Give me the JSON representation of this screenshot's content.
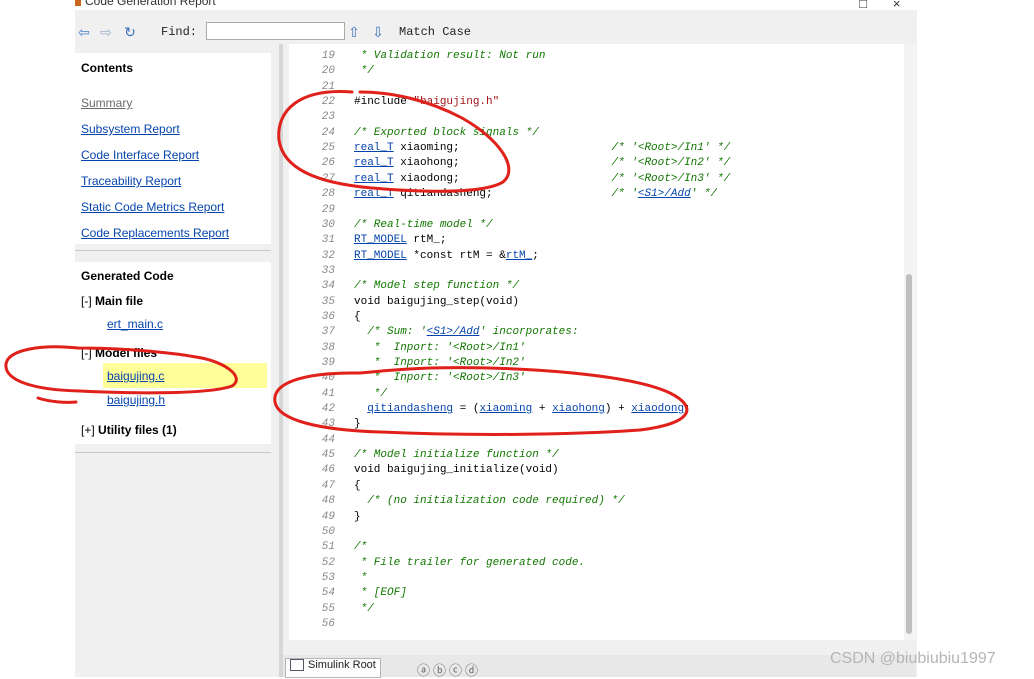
{
  "window": {
    "title": "Code Generation Report",
    "controls": {
      "minimize": "□",
      "close": "×"
    }
  },
  "toolbar": {
    "back_icon": "back-arrow-icon",
    "forward_icon": "forward-arrow-icon",
    "refresh_icon": "refresh-icon",
    "find_label": "Find:",
    "find_value": "",
    "find_prev_icon": "up-arrow-icon",
    "find_next_icon": "down-arrow-icon",
    "match_case": "Match Case"
  },
  "contents": {
    "heading": "Contents",
    "links": [
      "Summary",
      "Subsystem Report",
      "Code Interface Report",
      "Traceability Report",
      "Static Code Metrics Report",
      "Code Replacements Report"
    ]
  },
  "generated": {
    "heading": "Generated Code",
    "groups": [
      {
        "toggle": "[-]",
        "label": "Main file",
        "files": [
          "ert_main.c"
        ]
      },
      {
        "toggle": "[-]",
        "label": "Model files",
        "files": [
          "baigujing.c",
          "baigujing.h"
        ]
      },
      {
        "toggle": "[+]",
        "label": "Utility files (1)",
        "files": []
      }
    ]
  },
  "code": [
    {
      "n": "19",
      "t": " * Validation result: Not run"
    },
    {
      "n": "20",
      "t": " */"
    },
    {
      "n": "21",
      "t": ""
    },
    {
      "n": "22",
      "t": "#include \"baigujing.h\""
    },
    {
      "n": "23",
      "t": ""
    },
    {
      "n": "24",
      "t": "/* Exported block signals */"
    },
    {
      "n": "25",
      "t": "real_T xiaoming;                       /* '<Root>/In1' */"
    },
    {
      "n": "26",
      "t": "real_T xiaohong;                       /* '<Root>/In2' */"
    },
    {
      "n": "27",
      "t": "real_T xiaodong;                       /* '<Root>/In3' */"
    },
    {
      "n": "28",
      "t": "real_T qitiandasheng;                  /* '<S1>/Add' */"
    },
    {
      "n": "29",
      "t": ""
    },
    {
      "n": "30",
      "t": "/* Real-time model */"
    },
    {
      "n": "31",
      "t": "RT_MODEL rtM_;"
    },
    {
      "n": "32",
      "t": "RT_MODEL *const rtM = &rtM_;"
    },
    {
      "n": "33",
      "t": ""
    },
    {
      "n": "34",
      "t": "/* Model step function */"
    },
    {
      "n": "35",
      "t": "void baigujing_step(void)"
    },
    {
      "n": "36",
      "t": "{"
    },
    {
      "n": "37",
      "t": "  /* Sum: '<S1>/Add' incorporates:"
    },
    {
      "n": "38",
      "t": "   *  Inport: '<Root>/In1'"
    },
    {
      "n": "39",
      "t": "   *  Inport: '<Root>/In2'"
    },
    {
      "n": "40",
      "t": "   *  Inport: '<Root>/In3'"
    },
    {
      "n": "41",
      "t": "   */"
    },
    {
      "n": "42",
      "t": "  qitiandasheng = (xiaoming + xiaohong) + xiaodong;"
    },
    {
      "n": "43",
      "t": "}"
    },
    {
      "n": "44",
      "t": ""
    },
    {
      "n": "45",
      "t": "/* Model initialize function */"
    },
    {
      "n": "46",
      "t": "void baigujing_initialize(void)"
    },
    {
      "n": "47",
      "t": "{"
    },
    {
      "n": "48",
      "t": "  /* (no initialization code required) */"
    },
    {
      "n": "49",
      "t": "}"
    },
    {
      "n": "50",
      "t": ""
    },
    {
      "n": "51",
      "t": "/*"
    },
    {
      "n": "52",
      "t": " * File trailer for generated code."
    },
    {
      "n": "53",
      "t": " *"
    },
    {
      "n": "54",
      "t": " * [EOF]"
    },
    {
      "n": "55",
      "t": " */"
    },
    {
      "n": "56",
      "t": ""
    }
  ],
  "bottom": {
    "tab_label": "Simulink Root",
    "nav_controls": "ⓐⓑⓒⓓ"
  },
  "watermark": "CSDN @biubiubiu1997"
}
